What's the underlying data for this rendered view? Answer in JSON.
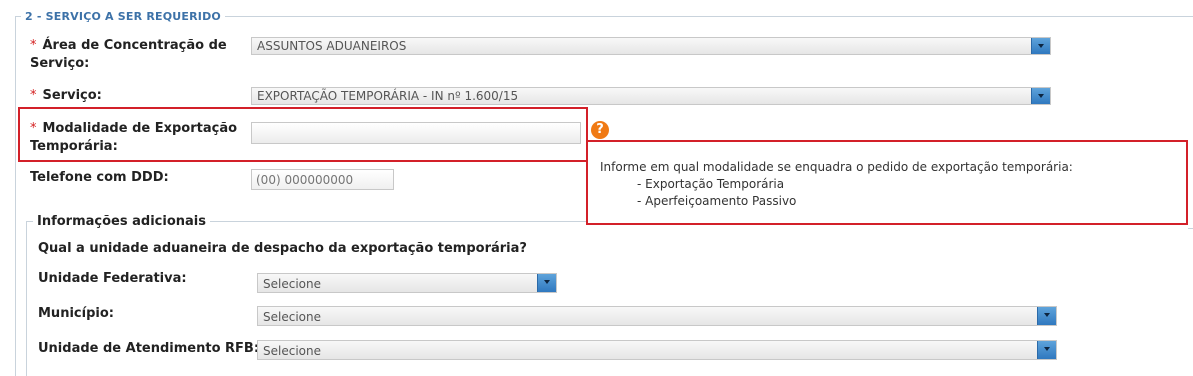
{
  "section": {
    "title": "2 - SERVIÇO A SER REQUERIDO"
  },
  "fields": {
    "area": {
      "label_line1": "Área de Concentração de",
      "label_line2": "Serviço:",
      "value": "ASSUNTOS ADUANEIROS"
    },
    "servico": {
      "label": "Serviço:",
      "value": "EXPORTAÇÃO TEMPORÁRIA - IN nº 1.600/15"
    },
    "modalidade": {
      "label_line1": "Modalidade de Exportação",
      "label_line2": "Temporária:",
      "value": ""
    },
    "telefone": {
      "label": "Telefone com DDD:",
      "placeholder": "(00) 000000000"
    }
  },
  "required_marker": "*",
  "help": {
    "icon_glyph": "?",
    "tooltip_intro": "Informe em qual modalidade se enquadra o pedido de exportação temporária:",
    "tooltip_items": [
      "- Exportação Temporária",
      "- Aperfeiçoamento Passivo"
    ]
  },
  "additional": {
    "title": "Informações adicionais",
    "question": "Qual a unidade aduaneira de despacho da exportação temporária?",
    "uf": {
      "label": "Unidade Federativa:",
      "value": "Selecione"
    },
    "municipio": {
      "label": "Município:",
      "value": "Selecione"
    },
    "unidade": {
      "label": "Unidade de Atendimento RFB:",
      "value": "Selecione"
    }
  },
  "colors": {
    "highlight": "#d32029",
    "legend": "#3d72a8",
    "required": "#d31e1e",
    "help_icon": "#f07a14",
    "dropdown_button": "#2f78bf"
  }
}
